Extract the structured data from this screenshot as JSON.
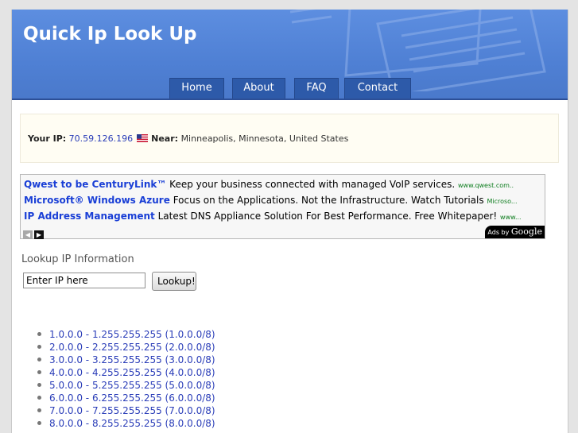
{
  "header": {
    "site_title": "Quick Ip Look Up"
  },
  "nav": {
    "items": [
      {
        "label": "Home"
      },
      {
        "label": "About"
      },
      {
        "label": "FAQ"
      },
      {
        "label": "Contact"
      }
    ]
  },
  "ip_info": {
    "ip_label": "Your IP:",
    "ip": "70.59.126.196",
    "flag": "us-flag-icon",
    "near_label": "Near:",
    "location": "Minneapolis, Minnesota, United States"
  },
  "ads": {
    "items": [
      {
        "title": "Qwest to be CenturyLink™",
        "desc": "Keep your business connected with managed VoIP services.",
        "url": "www.qwest.com.."
      },
      {
        "title": "Microsoft® Windows Azure",
        "desc": "Focus on the Applications. Not the Infrastructure. Watch Tutorials",
        "url": "Microso..."
      },
      {
        "title": "IP Address Management",
        "desc": "Latest DNS Appliance Solution For Best Performance. Free Whitepaper!",
        "url": "www..."
      }
    ],
    "prev_icon": "chevron-left-icon",
    "next_icon": "chevron-right-icon",
    "ads_by_prefix": "Ads by",
    "ads_by_brand": "Google"
  },
  "lookup": {
    "title": "Lookup IP Information",
    "input_value": "Enter IP here",
    "button_label": "Lookup!"
  },
  "ranges": [
    "1.0.0.0 - 1.255.255.255 (1.0.0.0/8)",
    "2.0.0.0 - 2.255.255.255 (2.0.0.0/8)",
    "3.0.0.0 - 3.255.255.255 (3.0.0.0/8)",
    "4.0.0.0 - 4.255.255.255 (4.0.0.0/8)",
    "5.0.0.0 - 5.255.255.255 (5.0.0.0/8)",
    "6.0.0.0 - 6.255.255.255 (6.0.0.0/8)",
    "7.0.0.0 - 7.255.255.255 (7.0.0.0/8)",
    "8.0.0.0 - 8.255.255.255 (8.0.0.0/8)"
  ],
  "colors": {
    "header_blue": "#4f80d4",
    "nav_blue": "#2d5aa9",
    "link_blue": "#2a3db8",
    "ad_title_blue": "#1a3fd6",
    "ad_url_green": "#0d7d1e"
  }
}
